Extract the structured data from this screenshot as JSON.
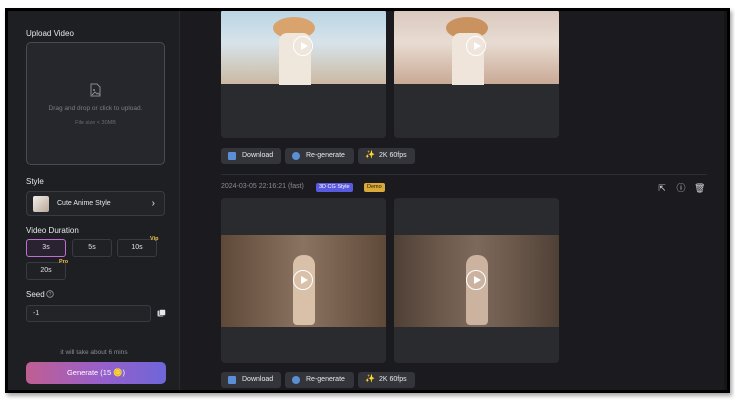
{
  "sidebar": {
    "upload_label": "Upload Video",
    "upload_hint": "Drag and drop or click to upload.",
    "upload_size": "File size < 30MB",
    "style_label": "Style",
    "style_value": "Cute Anime Style",
    "duration_label": "Video Duration",
    "durations": [
      "3s",
      "5s",
      "10s",
      "20s"
    ],
    "vip_badge": "Vip",
    "pro_badge": "Pro",
    "seed_label": "Seed",
    "seed_value": "-1",
    "estimate": "it will take about 6 mins",
    "generate_label": "Generate (15 🪙)"
  },
  "main": {
    "top_actions": {
      "download": "Download",
      "regenerate": "Re-generate",
      "upscale": "2K 60fps"
    },
    "entry": {
      "timestamp": "2024-03-05 22:16:21 (fast)",
      "style_tag": "3D CG Style",
      "demo_tag": "Demo"
    },
    "bottom_actions": {
      "download": "Download",
      "regenerate": "Re-generate",
      "upscale": "2K 60fps"
    }
  },
  "colors": {
    "accent_purple": "#6e66d8",
    "accent_pink": "#c05f91",
    "style_tag": "#5a5ae0",
    "demo_tag": "#d9a93a"
  }
}
